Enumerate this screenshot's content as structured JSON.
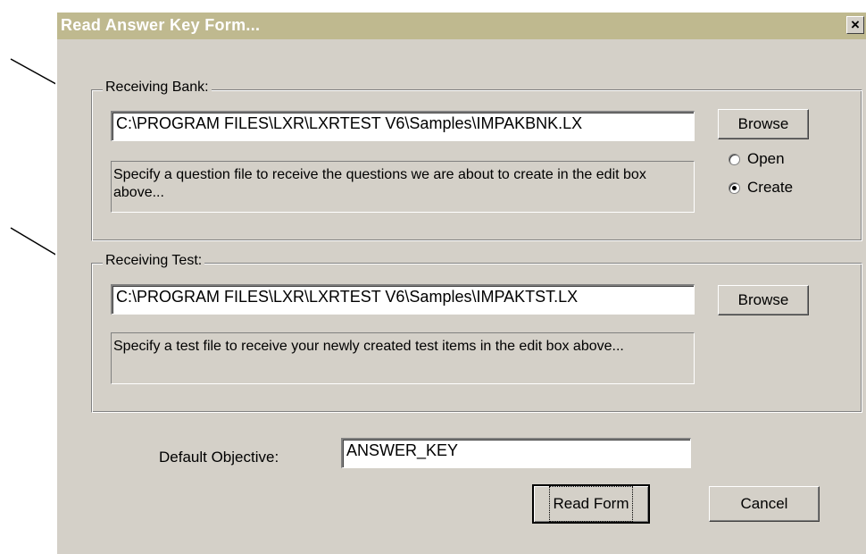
{
  "window": {
    "title": "Read Answer Key Form...",
    "close_glyph": "×"
  },
  "receiving_bank": {
    "legend": "Receiving Bank:",
    "path": "C:\\PROGRAM FILES\\LXR\\LXRTEST V6\\Samples\\IMPAKBNK.LX",
    "browse_label": "Browse",
    "hint": "Specify a question file to receive the questions we are about to create in the edit box above...",
    "open_label": "Open",
    "create_label": "Create",
    "selected_mode": "Create"
  },
  "receiving_test": {
    "legend": "Receiving Test:",
    "path": "C:\\PROGRAM FILES\\LXR\\LXRTEST V6\\Samples\\IMPAKTST.LX",
    "browse_label": "Browse",
    "hint": "Specify a test file to receive your newly created test items in the edit box above..."
  },
  "default_objective": {
    "label": "Default Objective:",
    "value": "ANSWER_KEY"
  },
  "buttons": {
    "read_form": "Read Form",
    "cancel": "Cancel"
  },
  "colors": {
    "titlebar": "#bfb98f",
    "dialog_face": "#d4d0c8"
  }
}
